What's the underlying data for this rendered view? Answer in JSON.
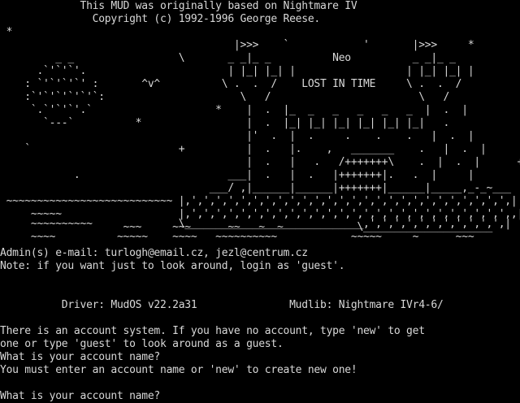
{
  "header": {
    "line1": "             This MUD was originally based on Nightmare IV",
    "line2": "               Copyright (c) 1992-1996 George Reese."
  },
  "art": [
    " *",
    "                                      |>>>    `            '       |>>>     *",
    "         _ _                 \\       _ _|_ _          Neo          _ _|_ _",
    "      .`'`'`'.                       | |_| |_| |                  | |_| |_| |",
    "    : `'`'`'`' :       ^v^          \\ .  .  /    LOST IN TIME     \\ .  .  /",
    "    :`'`'`'`'`'`:                      \\   /                        \\   /",
    "     `.`'`'`'.`                    *    |  .  |_  _   _   _   _   _  |  .  |",
    "       `---`          *                 |  .  |_| |_| |_| |_| |_| |_|   .",
    "                                        |'  .  |  .     .    .    .   |  .  |",
    "    `                        +          |  .   |.    ,   _______    .   |  .  |",
    "                                        |  .   |   .   /+++++++\\    .  |  .  |      +",
    "            .                        ___|  .   |  .   |+++++++|.   .  |     |",
    "                                  ___/ ,|______|______|+++++++|______|_____,_-_~___",
    " ~~~~~~~~~~~~~~~~~~~~~~~~~~~ |,',',',',',',',',',',',',',',',',',',',',',',',',',',|",
    "     ~~~~~                   |,',',',',',',',',',',',',',',',',',',',',',',',',',',,|",
    "     ~~~~~~~~~~              \\_____________________________,',',',',',',',',',',',|",
    "                    ~~~     ~~~      ~~   ~  ~            \\_____________________",
    "     ~~~~          ~~~~~    ~~~~   ~~~~~~~~~~            ~~~~~     ~      ~~~"
  ],
  "info": {
    "admin": "Admin(s) e-mail: turlogh@email.cz, jezl@centrum.cz",
    "note": "Note: if you want just to look around, login as 'guest'.",
    "driver": "          Driver: MudOS v22.2a31               Mudlib: Nightmare IVr4-6/"
  },
  "account": {
    "system_line1": "There is an account system. If you have no account, type 'new' to get",
    "system_line2": "one or type 'guest' to look around as a guest.",
    "question1": "What is your account name?",
    "error": "You must enter an account name or 'new' to create new one!",
    "prompt": "What is your account name?",
    "input_value": ""
  },
  "colors": {
    "background": "#000000",
    "foreground": "#d8d8d8"
  }
}
